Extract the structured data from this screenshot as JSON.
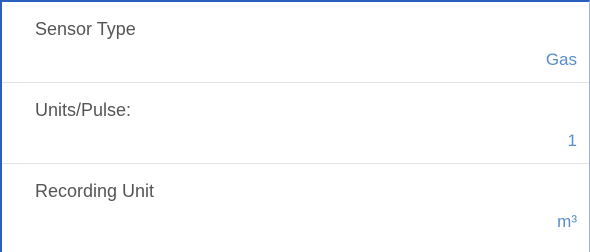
{
  "settings": {
    "rows": [
      {
        "label": "Sensor Type",
        "value": "Gas"
      },
      {
        "label": "Units/Pulse:",
        "value": "1"
      },
      {
        "label": "Recording Unit",
        "value": "m³"
      }
    ]
  },
  "colors": {
    "label": "#555555",
    "value": "#5b8ec8",
    "divider": "#e3e3e3",
    "frame": "#2b5fbf"
  }
}
